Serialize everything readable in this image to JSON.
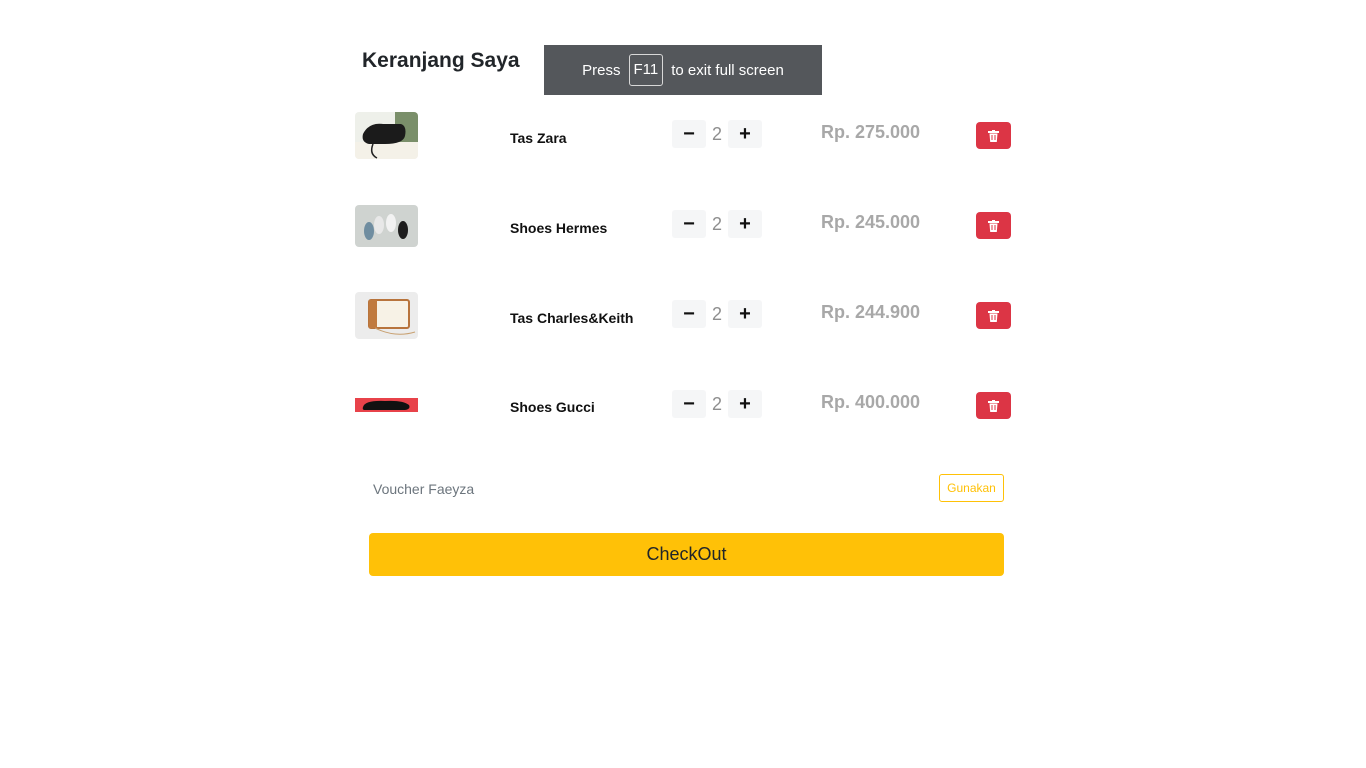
{
  "page": {
    "title": "Keranjang Saya"
  },
  "fullscreen_notice": {
    "press": "Press",
    "key": "F11",
    "rest": "to exit full screen"
  },
  "cart": {
    "items": [
      {
        "name": "Tas Zara",
        "qty": "2",
        "price": "Rp. 275.000",
        "thumb_icon": "black-bag-photo"
      },
      {
        "name": "Shoes Hermes",
        "qty": "2",
        "price": "Rp. 245.000",
        "thumb_icon": "shoes-photo"
      },
      {
        "name": "Tas Charles&Keith",
        "qty": "2",
        "price": "Rp. 244.900",
        "thumb_icon": "cream-bag-photo"
      },
      {
        "name": "Shoes Gucci",
        "qty": "2",
        "price": "Rp. 400.000",
        "thumb_icon": "loafer-photo"
      }
    ],
    "minus_label": "−",
    "plus_label": "+"
  },
  "voucher": {
    "label": "Voucher Faeyza",
    "button": "Gunakan"
  },
  "checkout": {
    "label": "CheckOut"
  },
  "colors": {
    "accent": "#ffc107",
    "danger": "#dc3545",
    "price": "#a8a8a8"
  }
}
